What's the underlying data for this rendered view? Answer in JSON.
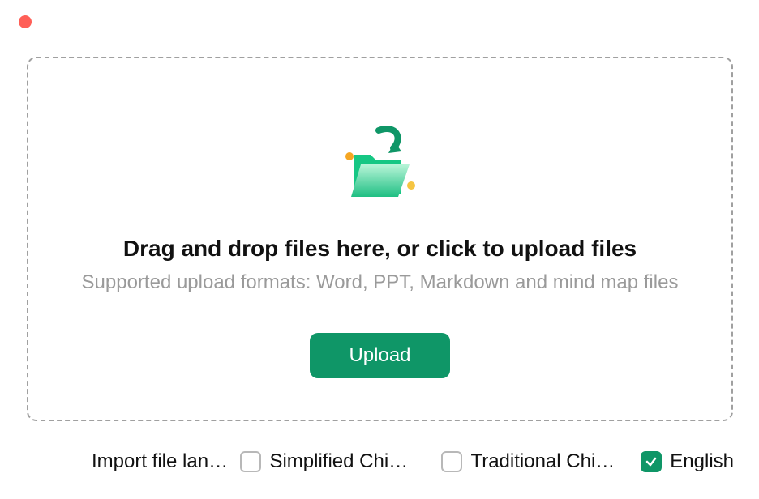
{
  "window": {
    "close_icon": "close"
  },
  "dropzone": {
    "heading": "Drag and drop files here, or click to upload files",
    "subtext": "Supported upload formats: Word, PPT, Markdown and mind map files",
    "upload_button_label": "Upload",
    "icon": "folder-import-icon"
  },
  "language_row": {
    "label": "Import file lang…",
    "options": [
      {
        "label": "Simplified Chin…",
        "checked": false
      },
      {
        "label": "Traditional Chi…",
        "checked": false
      },
      {
        "label": "English",
        "checked": true
      }
    ]
  },
  "colors": {
    "accent": "#0f9667",
    "close": "#ff5f57",
    "muted": "#9a9a9a"
  }
}
